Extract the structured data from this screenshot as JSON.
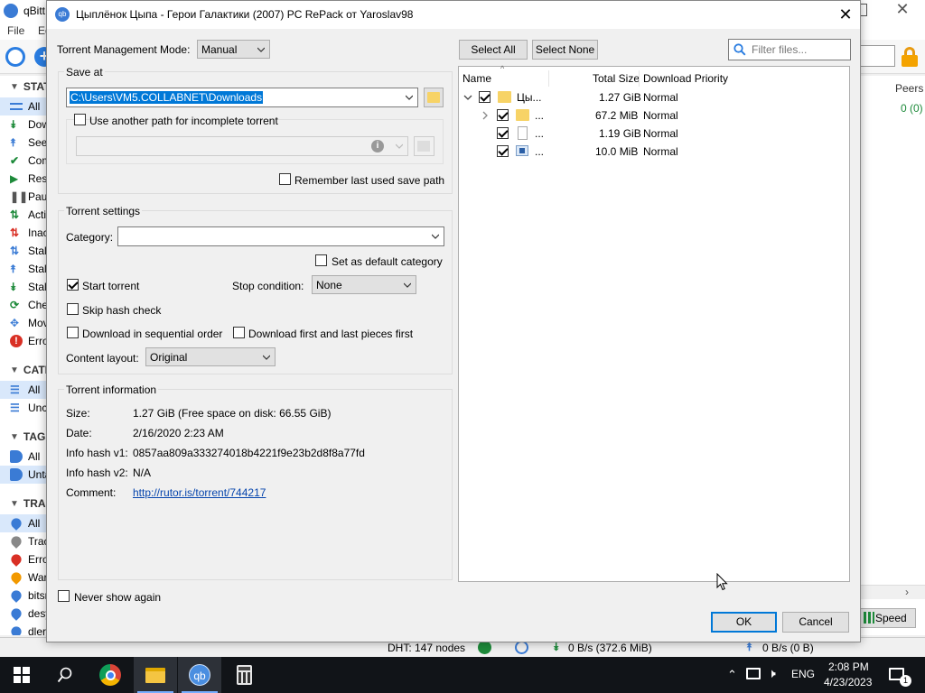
{
  "background_app": {
    "title": "qBittorrent",
    "menu": [
      "File",
      "Edit"
    ],
    "sidebar": {
      "status_header": "STATUS",
      "status_items": [
        "All",
        "Downloading",
        "Seeding",
        "Completed",
        "Resumed",
        "Paused",
        "Active",
        "Inactive",
        "Stalled",
        "Stalled Uploading",
        "Stalled Downloading",
        "Checking",
        "Moving",
        "Errored"
      ],
      "categories_header": "CATEGORIES",
      "category_items": [
        "All",
        "Uncategorized"
      ],
      "tags_header": "TAGS",
      "tag_items": [
        "All",
        "Untagged"
      ],
      "trackers_header": "TRACKERS",
      "tracker_items": [
        "All",
        "Trackerless",
        "Error",
        "Warning",
        "bitsnoop.com",
        "desync.com",
        "dler.org"
      ]
    },
    "right_panel": {
      "peers_header": "Peers",
      "peers_value": "0 (0)",
      "speed_button": "Speed"
    },
    "statusbar": {
      "dht": "DHT: 147 nodes",
      "download": "0 B/s (372.6 MiB)",
      "upload": "0 B/s (0 B)"
    }
  },
  "dialog": {
    "title": "Цыплёнок Цыпа - Герои Галактики (2007) PC RePack от Yaroslav98",
    "torrent_management_mode_label": "Torrent Management Mode:",
    "torrent_management_mode_value": "Manual",
    "save_at": {
      "title": "Save at",
      "path": "C:\\Users\\VM5.COLLABNET\\Downloads",
      "use_another_path_label": "Use another path for incomplete torrent",
      "use_another_path_checked": false,
      "remember_label": "Remember last used save path",
      "remember_checked": false
    },
    "torrent_settings": {
      "title": "Torrent settings",
      "category_label": "Category:",
      "category_value": "",
      "set_default_category_label": "Set as default category",
      "start_torrent_label": "Start torrent",
      "start_torrent_checked": true,
      "stop_condition_label": "Stop condition:",
      "stop_condition_value": "None",
      "skip_hash_label": "Skip hash check",
      "sequential_label": "Download in sequential order",
      "first_last_label": "Download first and last pieces first",
      "content_layout_label": "Content layout:",
      "content_layout_value": "Original"
    },
    "torrent_information": {
      "title": "Torrent information",
      "size_label": "Size:",
      "size_value": "1.27 GiB (Free space on disk: 66.55 GiB)",
      "date_label": "Date:",
      "date_value": "2/16/2020 2:23 AM",
      "hash_v1_label": "Info hash v1:",
      "hash_v1_value": "0857aa809a333274018b4221f9e23b2d8f8a77fd",
      "hash_v2_label": "Info hash v2:",
      "hash_v2_value": "N/A",
      "comment_label": "Comment:",
      "comment_value": "http://rutor.is/torrent/744217"
    },
    "never_show_label": "Never show again",
    "select_all": "Select All",
    "select_none": "Select None",
    "filter_placeholder": "Filter files...",
    "tree": {
      "columns": [
        "Name",
        "Total Size",
        "Download Priority"
      ],
      "rows": [
        {
          "name": "Цы...",
          "size": "1.27 GiB",
          "priority": "Normal",
          "icon": "folder-icon"
        },
        {
          "name": "...",
          "size": "67.2 MiB",
          "priority": "Normal",
          "icon": "folder-icon"
        },
        {
          "name": "...",
          "size": "1.19 GiB",
          "priority": "Normal",
          "icon": "file-icon"
        },
        {
          "name": "...",
          "size": "10.0 MiB",
          "priority": "Normal",
          "icon": "video-file-icon"
        }
      ]
    },
    "ok": "OK",
    "cancel": "Cancel"
  },
  "taskbar": {
    "language": "ENG",
    "time": "2:08 PM",
    "date": "4/23/2023",
    "notification_count": "1"
  }
}
